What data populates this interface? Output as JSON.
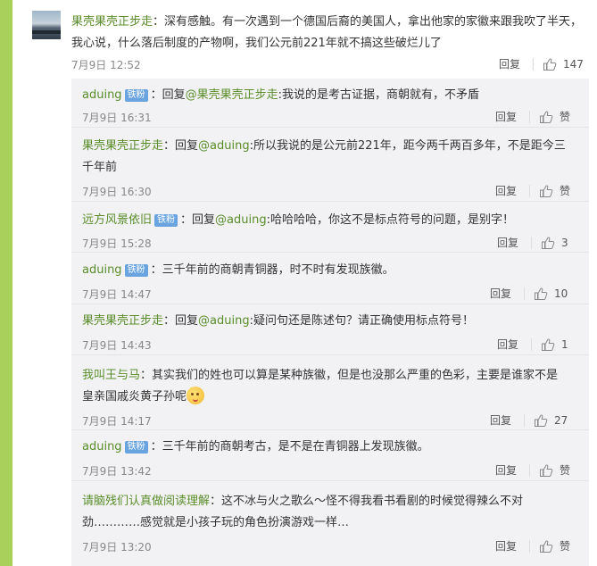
{
  "main": {
    "user": "果壳果壳正步走",
    "text": "：深有感触。有一次遇到一个德国后裔的美国人，拿出他家的家徽来跟我吹了半天，我心说，什么落后制度的产物啊，我们公元前221年就不搞这些破烂儿了",
    "time": "7月9日 12:52",
    "reply_label": "回复",
    "likes": "147"
  },
  "replies": [
    {
      "user": "aduing",
      "badge": "铁粉",
      "prefix": "：回复",
      "reply_to": "@果壳果壳正步走",
      "text": ":我说的是考古证据，商朝就有，不矛盾",
      "time": "7月9日 16:31",
      "reply_label": "回复",
      "likes": "赞"
    },
    {
      "user": "果壳果壳正步走",
      "badge": "",
      "prefix": "：回复",
      "reply_to": "@aduing",
      "text": ":所以我说的是公元前221年，距今两千两百多年，不是距今三千年前",
      "time": "7月9日 16:30",
      "reply_label": "回复",
      "likes": "赞"
    },
    {
      "user": "远方风景依旧",
      "badge": "铁粉",
      "prefix": "：回复",
      "reply_to": "@aduing",
      "text": ":哈哈哈哈，你这不是标点符号的问题，是别字！",
      "time": "7月9日 15:28",
      "reply_label": "回复",
      "likes": "3"
    },
    {
      "user": "aduing",
      "badge": "铁粉",
      "prefix": "",
      "reply_to": "",
      "text": "：三千年前的商朝青铜器，时不时有发现族徽。",
      "time": "7月9日 14:47",
      "reply_label": "回复",
      "likes": "10"
    },
    {
      "user": "果壳果壳正步走",
      "badge": "",
      "prefix": "：回复",
      "reply_to": "@aduing",
      "text": ":疑问句还是陈述句？请正确使用标点符号！",
      "time": "7月9日 14:43",
      "reply_label": "回复",
      "likes": "1"
    },
    {
      "user": "我叫王与马",
      "badge": "",
      "prefix": "",
      "reply_to": "",
      "text": "：其实我们的姓也可以算是某种族徽，但是也没那么严重的色彩，主要是谁家不是皇亲国戚炎黄子孙呢",
      "time": "7月9日 14:17",
      "reply_label": "回复",
      "likes": "27"
    },
    {
      "user": "aduing",
      "badge": "铁粉",
      "prefix": "",
      "reply_to": "",
      "text": "：三千年前的商朝考古，是不是在青铜器上发现族徽。",
      "time": "7月9日 13:42",
      "reply_label": "回复",
      "likes": "赞"
    },
    {
      "user": "请脑残们认真做阅读理解",
      "badge": "",
      "prefix": "",
      "reply_to": "",
      "text": "：这不冰与火之歌么～怪不得我看书看剧的时候觉得辣么不对劲…………感觉就是小孩子玩的角色扮演游戏一样…",
      "time": "7月9日 13:20",
      "reply_label": "回复",
      "likes": "赞"
    }
  ]
}
